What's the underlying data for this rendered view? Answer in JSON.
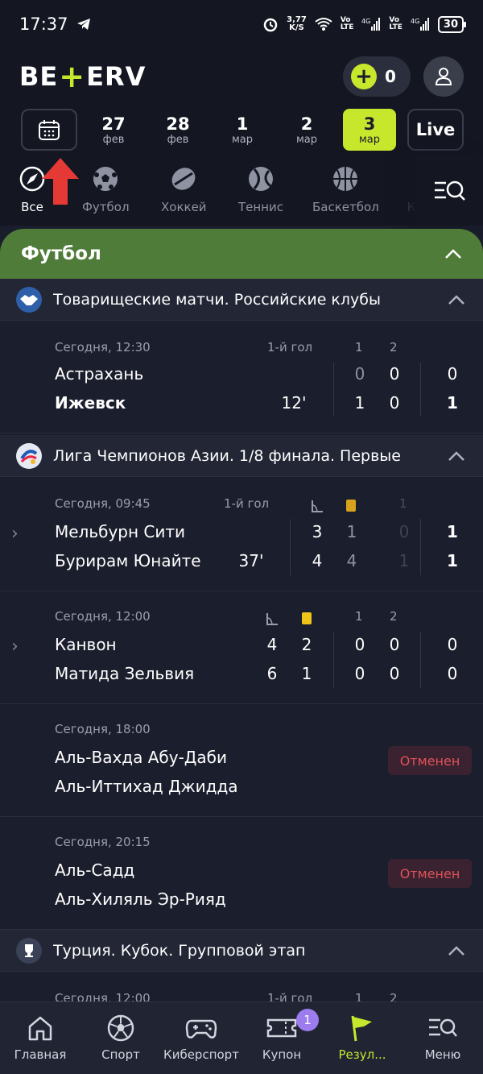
{
  "status_bar": {
    "time": "17:37",
    "speed_top": "3,77",
    "speed_bottom": "K/S",
    "net1": "Vo\nLTE",
    "net2": "4G",
    "net3": "Vo\nLTE",
    "net4": "4G",
    "battery": "30"
  },
  "header": {
    "logo_left": "BE",
    "logo_right": "ERV",
    "balance": "0"
  },
  "dates": [
    {
      "day": "27",
      "month": "фев"
    },
    {
      "day": "28",
      "month": "фев"
    },
    {
      "day": "1",
      "month": "мар"
    },
    {
      "day": "2",
      "month": "мар"
    },
    {
      "day": "3",
      "month": "мар"
    }
  ],
  "live_label": "Live",
  "sports": [
    {
      "label": "Все",
      "icon": "compass-icon"
    },
    {
      "label": "Футбол",
      "icon": "soccer-ball-icon"
    },
    {
      "label": "Хоккей",
      "icon": "hockey-puck-icon"
    },
    {
      "label": "Теннис",
      "icon": "tennis-ball-icon"
    },
    {
      "label": "Баскетбол",
      "icon": "basketball-icon"
    },
    {
      "label": "Ки",
      "icon": "cyber-icon"
    }
  ],
  "section_title": "Футбол",
  "leagues": [
    {
      "title": "Товарищеские матчи. Российские клубы",
      "matches": [
        {
          "time": "Сегодня, 12:30",
          "goal_label": "1-й гол",
          "h1": "1",
          "h2": "2",
          "team1": "Астрахань",
          "team2": "Ижевск",
          "minute": "12'",
          "t1": [
            "0",
            "0",
            "0"
          ],
          "t2": [
            "1",
            "0",
            "1"
          ]
        }
      ]
    },
    {
      "title": "Лига Чемпионов Азии. 1/8 финала. Первые",
      "matches": [
        {
          "time": "Сегодня, 09:45",
          "goal_label": "1-й гол",
          "h3": "1",
          "team1": "Мельбурн Сити",
          "team2": "Бурирам Юнайте",
          "minute": "37'",
          "t1": [
            "3",
            "1",
            "0",
            "1"
          ],
          "t2": [
            "4",
            "4",
            "1",
            "1"
          ]
        },
        {
          "time": "Сегодня, 12:00",
          "h1": "1",
          "h2": "2",
          "team1": "Канвон",
          "team2": "Матида Зельвия",
          "t1": [
            "4",
            "2",
            "0",
            "0",
            "0"
          ],
          "t2": [
            "6",
            "1",
            "0",
            "0",
            "0"
          ]
        },
        {
          "time": "Сегодня, 18:00",
          "team1": "Аль-Вахда Абу-Даби",
          "team2": "Аль-Иттихад Джидда",
          "status": "Отменен"
        },
        {
          "time": "Сегодня, 20:15",
          "team1": "Аль-Садд",
          "team2": "Аль-Хиляль Эр-Рияд",
          "status": "Отменен"
        }
      ]
    },
    {
      "title": "Турция. Кубок. Групповой этап",
      "matches": [
        {
          "time": "Сегодня, 12:00",
          "goal_label": "1-й гол",
          "h1": "1",
          "h2": "2"
        }
      ]
    }
  ],
  "bottom_nav": [
    {
      "label": "Главная",
      "icon": "home-icon"
    },
    {
      "label": "Спорт",
      "icon": "soccer-ball-icon"
    },
    {
      "label": "Киберспорт",
      "icon": "gamepad-icon"
    },
    {
      "label": "Купон",
      "icon": "coupon-icon",
      "badge": "1"
    },
    {
      "label": "Резул...",
      "icon": "flag-icon"
    },
    {
      "label": "Меню",
      "icon": "menu-search-icon"
    }
  ],
  "colors": {
    "accent": "#c7e72d",
    "section": "#507c3a",
    "cancel": "#e0525a",
    "arrow": "#e53935"
  }
}
